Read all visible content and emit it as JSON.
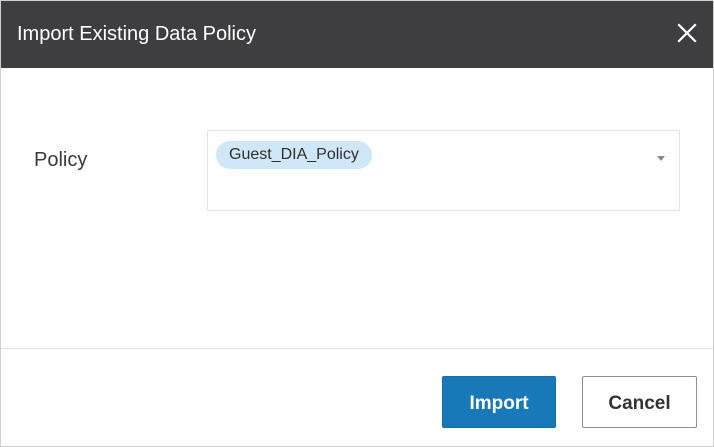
{
  "dialog": {
    "title": "Import Existing Data Policy",
    "close_icon": "close-icon"
  },
  "form": {
    "policy_label": "Policy",
    "policy_select": {
      "selected": [
        "Guest_DIA_Policy"
      ],
      "dropdown_icon": "chevron-down-icon"
    }
  },
  "footer": {
    "import_label": "Import",
    "cancel_label": "Cancel"
  },
  "colors": {
    "titlebar_bg": "#3e3e41",
    "primary_button": "#1978b8",
    "chip_bg": "#cfe7f6"
  }
}
